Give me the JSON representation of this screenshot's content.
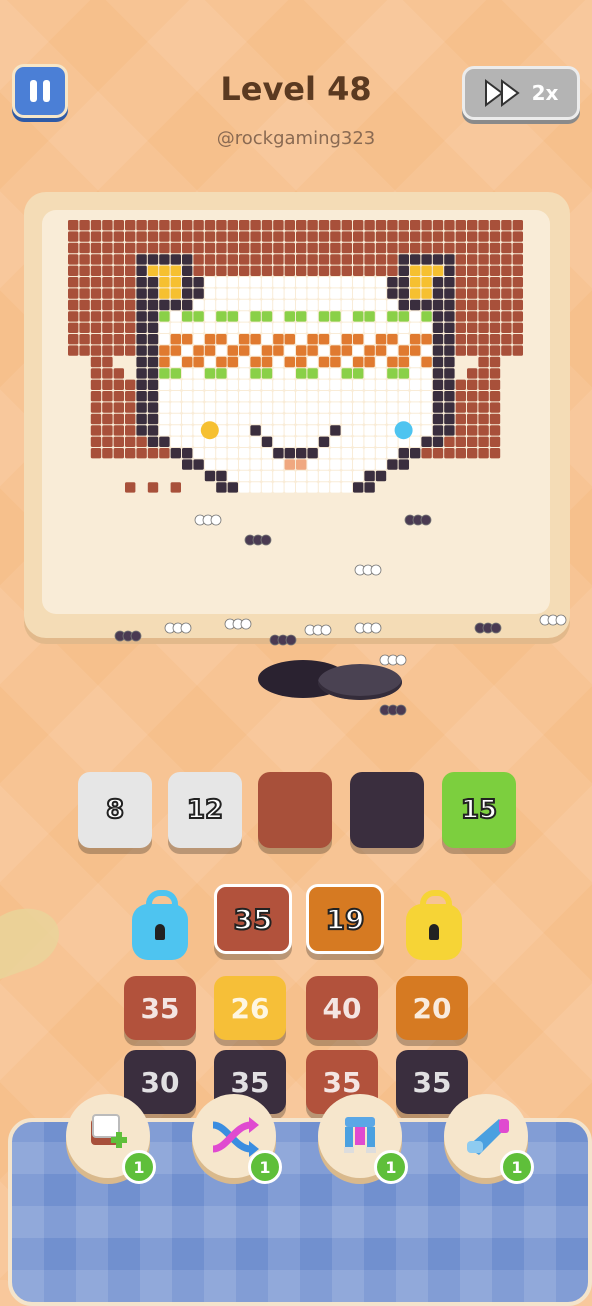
{
  "header": {
    "title": "Level 48",
    "subtitle": "@rockgaming323",
    "speed_label": "2x"
  },
  "slots": [
    {
      "label": "8",
      "color": "#e6e6e6"
    },
    {
      "label": "12",
      "color": "#e6e6e6"
    },
    {
      "label": "",
      "color": "#a8503a"
    },
    {
      "label": "",
      "color": "#3a2e3e"
    },
    {
      "label": "15",
      "color": "#7ccf3e"
    }
  ],
  "grid": {
    "row1": [
      {
        "label": "35",
        "color": "#b2523c"
      },
      {
        "label": "19",
        "color": "#d67a22"
      }
    ],
    "row2": [
      {
        "label": "35",
        "color": "#b2523c"
      },
      {
        "label": "26",
        "color": "#f6bf38"
      },
      {
        "label": "40",
        "color": "#b2523c"
      },
      {
        "label": "20",
        "color": "#d67a22"
      }
    ],
    "row3": [
      {
        "label": "30",
        "color": "#3a2e3e"
      },
      {
        "label": "35",
        "color": "#3a2e3e"
      },
      {
        "label": "35",
        "color": "#b2523c"
      },
      {
        "label": "35",
        "color": "#3a2e3e"
      }
    ],
    "locks": [
      {
        "color": "#4ec4f0",
        "icon": "lock-icon"
      },
      {
        "color": "#f6d436",
        "icon": "lock-icon"
      }
    ]
  },
  "boosters": [
    {
      "icon": "add-slot-icon",
      "count": "1"
    },
    {
      "icon": "shuffle-icon",
      "count": "1"
    },
    {
      "icon": "magnet-icon",
      "count": "1"
    },
    {
      "icon": "vacuum-icon",
      "count": "1"
    }
  ],
  "palette": {
    "brown": "#a8503a",
    "dark": "#3a2e3e",
    "white": "#ffffff",
    "orange": "#e07a30",
    "green": "#8ad048",
    "yellow": "#f6c030",
    "pink": "#f0a880",
    "blue": "#4ec4f0"
  }
}
